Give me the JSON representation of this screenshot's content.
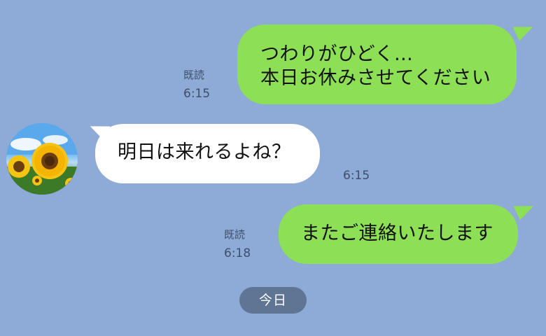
{
  "messages": [
    {
      "side": "sent",
      "text": "つわりがひどく…\n本日お休みさせてください",
      "read_label": "既読",
      "time": "6:15"
    },
    {
      "side": "received",
      "text": "明日は来れるよね？",
      "time": "6:15"
    },
    {
      "side": "sent",
      "text": "またご連絡いたします",
      "read_label": "既読",
      "time": "6:18"
    }
  ],
  "date_separator": "今日",
  "colors": {
    "background": "#8eaad6",
    "sent_bubble": "#8de055",
    "received_bubble": "#ffffff",
    "date_pill": "#5f7593"
  },
  "avatar_icon": "sunflower-avatar-icon"
}
